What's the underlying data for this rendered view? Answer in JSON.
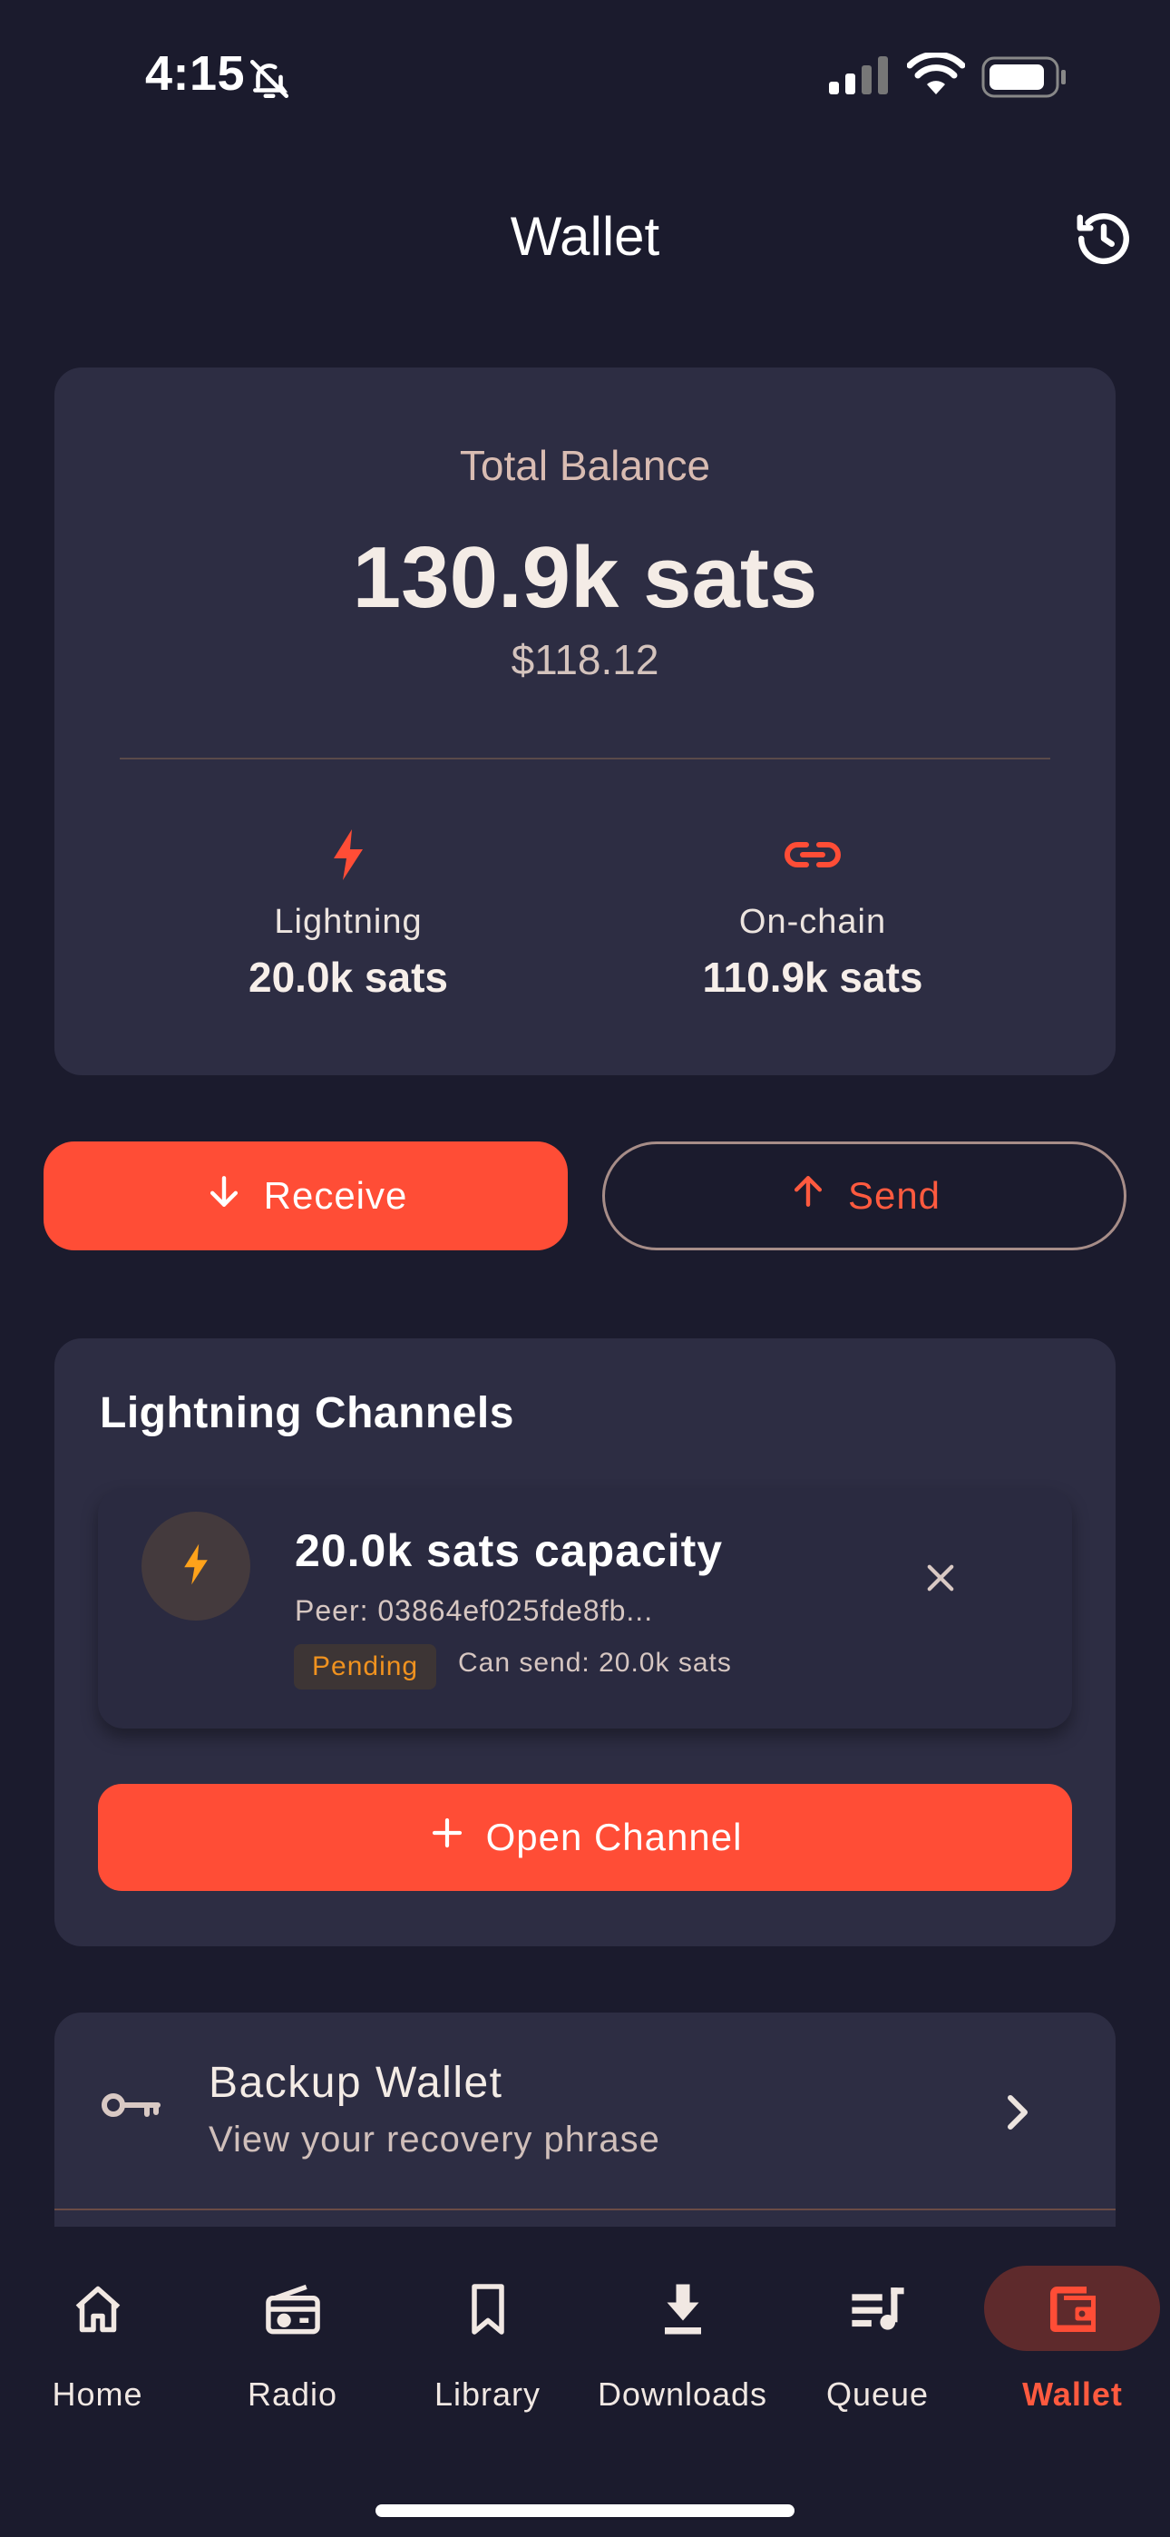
{
  "status_bar": {
    "time": "4:15"
  },
  "header": {
    "title": "Wallet"
  },
  "balance": {
    "label": "Total Balance",
    "sats": "130.9k sats",
    "fiat": "$118.12",
    "lightning": {
      "label": "Lightning",
      "value": "20.0k sats"
    },
    "onchain": {
      "label": "On-chain",
      "value": "110.9k sats"
    }
  },
  "actions": {
    "receive_label": "Receive",
    "send_label": "Send"
  },
  "channels": {
    "title": "Lightning Channels",
    "items": [
      {
        "capacity": "20.0k sats capacity",
        "peer": "Peer: 03864ef025fde8fb...",
        "status": "Pending",
        "can_send": "Can send: 20.0k sats"
      }
    ],
    "open_label": "Open Channel"
  },
  "backup": {
    "title": "Backup Wallet",
    "subtitle": "View your recovery phrase"
  },
  "nav": {
    "items": [
      {
        "label": "Home",
        "icon": "home-icon"
      },
      {
        "label": "Radio",
        "icon": "radio-icon"
      },
      {
        "label": "Library",
        "icon": "bookmark-icon"
      },
      {
        "label": "Downloads",
        "icon": "download-icon"
      },
      {
        "label": "Queue",
        "icon": "queue-icon"
      },
      {
        "label": "Wallet",
        "icon": "wallet-icon",
        "active": true
      }
    ]
  },
  "colors": {
    "background": "#1b1b2d",
    "card": "#2d2d43",
    "accent": "#ff4d36",
    "pending": "#f0921f",
    "lightning_bolt": "#ffa21a"
  }
}
